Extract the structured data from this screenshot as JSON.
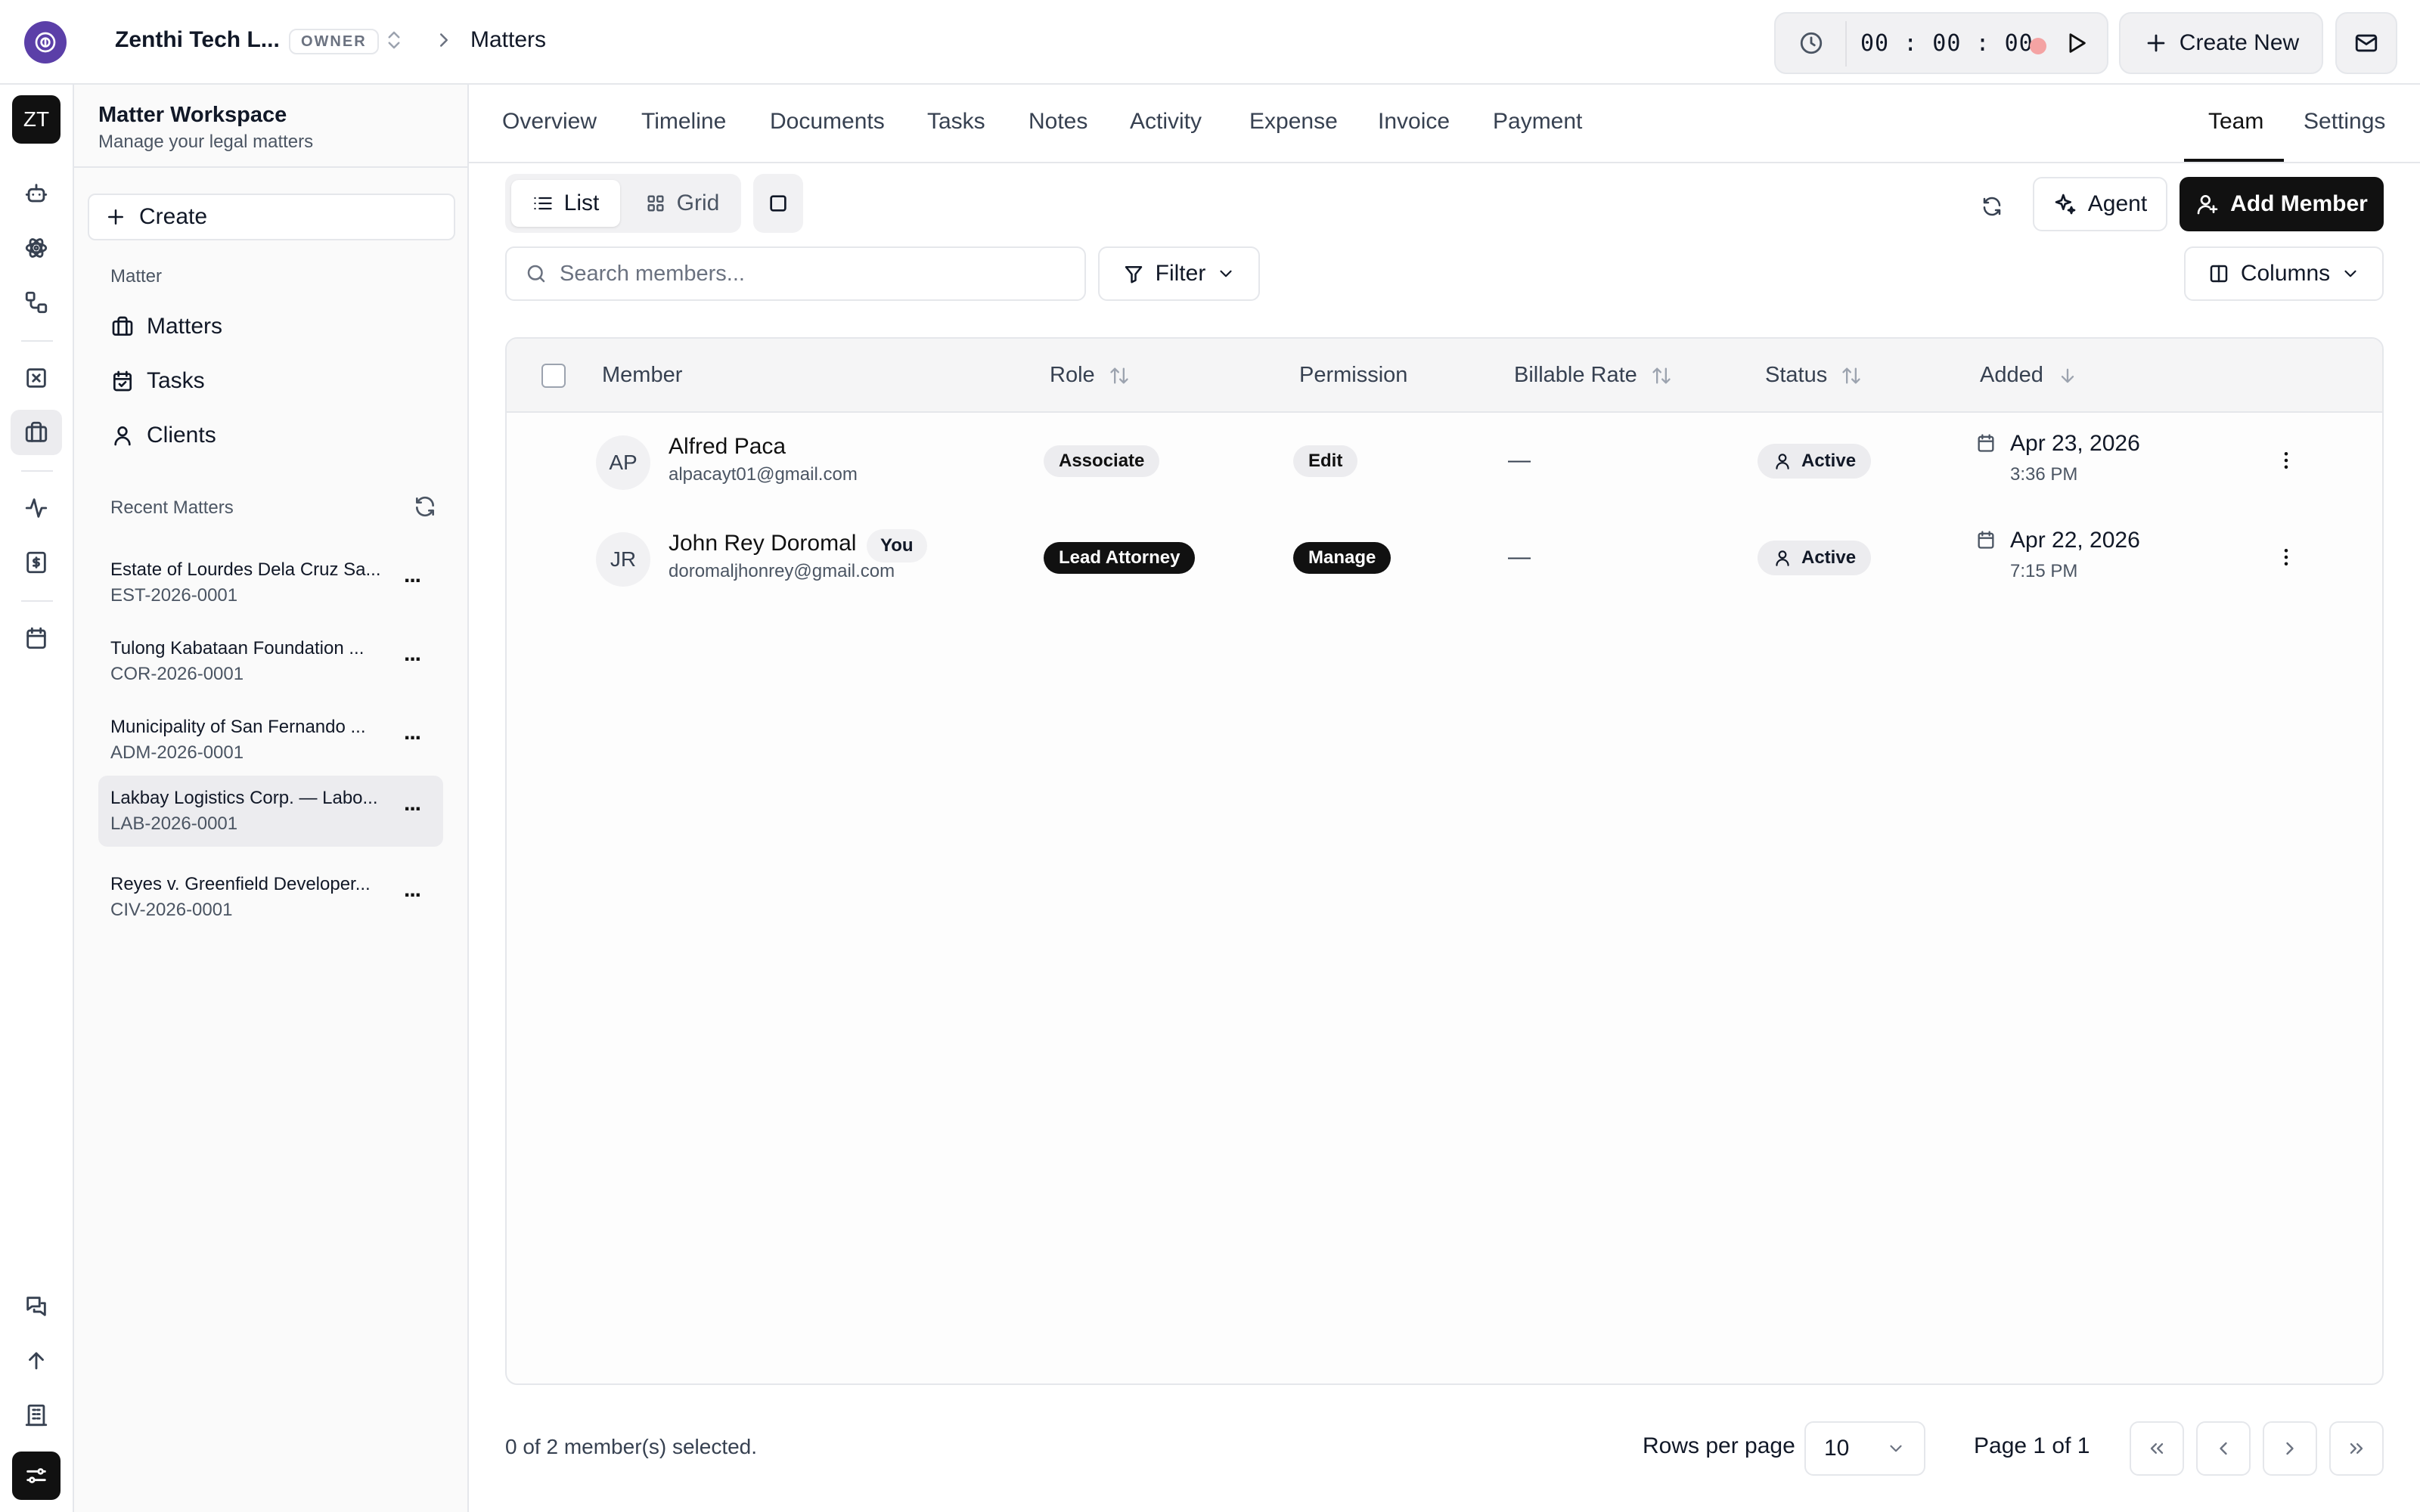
{
  "topbar": {
    "workspace_name": "Zenthi Tech L...",
    "role_badge": "OWNER",
    "breadcrumb": "Matters",
    "timer": "00 : 00 : 00",
    "create_new_label": "Create New"
  },
  "rail": {
    "workspace_initials": "ZT",
    "icons": [
      "bot-icon",
      "atom-icon",
      "workflow-icon",
      "x-square-icon",
      "briefcase-icon",
      "activity-icon",
      "dollar-receipt-icon",
      "calendar-icon"
    ],
    "bottom_icons": [
      "messages-icon",
      "arrow-up-icon",
      "building-icon",
      "sliders-icon"
    ]
  },
  "sidebar": {
    "title": "Matter Workspace",
    "subtitle": "Manage your legal matters",
    "create_label": "Create",
    "section_matter": "Matter",
    "items": [
      {
        "label": "Matters",
        "icon": "briefcase-icon"
      },
      {
        "label": "Tasks",
        "icon": "calendar-check-icon"
      },
      {
        "label": "Clients",
        "icon": "user-icon"
      }
    ],
    "recent_label": "Recent Matters",
    "recent": [
      {
        "title": "Estate of Lourdes Dela Cruz Sa...",
        "code": "EST-2026-0001"
      },
      {
        "title": "Tulong Kabataan Foundation ...",
        "code": "COR-2026-0001"
      },
      {
        "title": "Municipality of San Fernando ...",
        "code": "ADM-2026-0001"
      },
      {
        "title": "Lakbay Logistics Corp. — Labo...",
        "code": "LAB-2026-0001",
        "active": true
      },
      {
        "title": "Reyes v. Greenfield Developer...",
        "code": "CIV-2026-0001"
      }
    ],
    "more_label": "..."
  },
  "tabs": [
    "Overview",
    "Timeline",
    "Documents",
    "Tasks",
    "Notes",
    "Activity",
    "Expense",
    "Invoice",
    "Payment"
  ],
  "tabs_right": [
    "Team",
    "Settings"
  ],
  "active_tab": "Team",
  "toolbar": {
    "list_label": "List",
    "grid_label": "Grid",
    "agent_label": "Agent",
    "add_member_label": "Add Member",
    "search_placeholder": "Search members...",
    "filter_label": "Filter",
    "columns_label": "Columns"
  },
  "table": {
    "headers": {
      "member": "Member",
      "role": "Role",
      "permission": "Permission",
      "billable_rate": "Billable Rate",
      "status": "Status",
      "added": "Added"
    },
    "rows": [
      {
        "initials": "AP",
        "name": "Alfred Paca",
        "email": "alpacayt01@gmail.com",
        "you": "",
        "role": "Associate",
        "permission": "Edit",
        "billable_rate": "—",
        "status": "Active",
        "added_date": "Apr 23, 2026",
        "added_time": "3:36 PM"
      },
      {
        "initials": "JR",
        "name": "John Rey Doromal",
        "email": "doromaljhonrey@gmail.com",
        "you": "You",
        "role": "Lead Attorney",
        "permission": "Manage",
        "billable_rate": "—",
        "status": "Active",
        "added_date": "Apr 22, 2026",
        "added_time": "7:15 PM"
      }
    ]
  },
  "footer": {
    "selected_text": "0 of 2 member(s) selected.",
    "rows_per_page_label": "Rows per page",
    "rows_per_page_value": "10",
    "page_text": "Page 1 of 1"
  },
  "colors": {
    "brand_purple": "#5b3fa8",
    "primary_black": "#111111",
    "recording_dot": "#f4a3a3"
  }
}
